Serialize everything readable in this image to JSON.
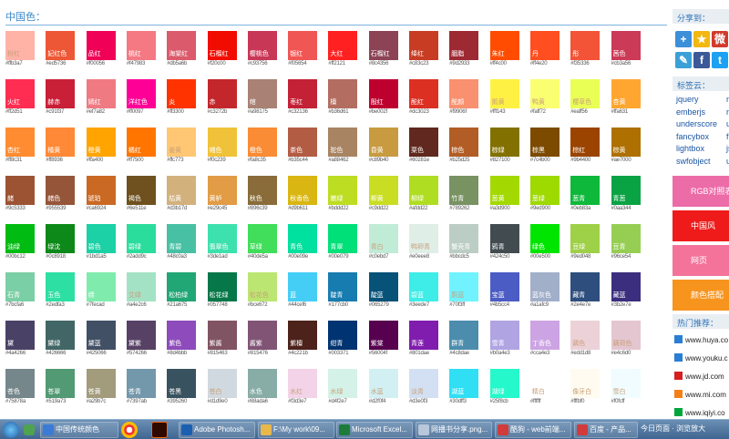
{
  "page": {
    "title": "中国色："
  },
  "colors": [
    {
      "name": "粉红",
      "hex": "#ffb3a7"
    },
    {
      "name": "妃红色",
      "hex": "#ed5736"
    },
    {
      "name": "品红",
      "hex": "#f00056"
    },
    {
      "name": "桃红",
      "hex": "#f47983"
    },
    {
      "name": "海棠红",
      "hex": "#db5a6b"
    },
    {
      "name": "石榴红",
      "hex": "#f20c00"
    },
    {
      "name": "樱桃色",
      "hex": "#c93756"
    },
    {
      "name": "银红",
      "hex": "#f05654"
    },
    {
      "name": "大红",
      "hex": "#ff2121"
    },
    {
      "name": "石榴红",
      "hex": "#8c4356"
    },
    {
      "name": "绛红",
      "hex": "#c83c23"
    },
    {
      "name": "胭脂",
      "hex": "#9d2933"
    },
    {
      "name": "朱红",
      "hex": "#ff4c00"
    },
    {
      "name": "丹",
      "hex": "#ff4e20"
    },
    {
      "name": "彤",
      "hex": "#f35336"
    },
    {
      "name": "茜色",
      "hex": "#cb3a56"
    },
    {
      "name": "火红",
      "hex": "#ff2d51"
    },
    {
      "name": "赫赤",
      "hex": "#c91f37"
    },
    {
      "name": "嫣红",
      "hex": "#ef7a82"
    },
    {
      "name": "洋红色",
      "hex": "#ff0097"
    },
    {
      "name": "炎",
      "hex": "#ff3300"
    },
    {
      "name": "赤",
      "hex": "#c3272b"
    },
    {
      "name": "绾",
      "hex": "#a98175"
    },
    {
      "name": "枣红",
      "hex": "#c32136"
    },
    {
      "name": "檀",
      "hex": "#b36d61"
    },
    {
      "name": "殷红",
      "hex": "#be002f"
    },
    {
      "name": "酡红",
      "hex": "#dc3023"
    },
    {
      "name": "酡颜",
      "hex": "#f9906f"
    },
    {
      "name": "鹅黄",
      "hex": "#fff143"
    },
    {
      "name": "鸭黄",
      "hex": "#faff72"
    },
    {
      "name": "樱草色",
      "hex": "#eaff56"
    },
    {
      "name": "杏黄",
      "hex": "#ffa631"
    },
    {
      "name": "杏红",
      "hex": "#ff8c31"
    },
    {
      "name": "橘黄",
      "hex": "#ff8936"
    },
    {
      "name": "橙黄",
      "hex": "#ffa400"
    },
    {
      "name": "橘红",
      "hex": "#ff7500"
    },
    {
      "name": "姜黄",
      "hex": "#ffc773"
    },
    {
      "name": "缃色",
      "hex": "#f0c239"
    },
    {
      "name": "橙色",
      "hex": "#fa8c35"
    },
    {
      "name": "茶色",
      "hex": "#b35c44"
    },
    {
      "name": "驼色",
      "hex": "#a88462"
    },
    {
      "name": "昏黄",
      "hex": "#c89b40"
    },
    {
      "name": "栗色",
      "hex": "#60281e"
    },
    {
      "name": "棕色",
      "hex": "#b25d25"
    },
    {
      "name": "棕绿",
      "hex": "#827100"
    },
    {
      "name": "棕黑",
      "hex": "#7c4b00"
    },
    {
      "name": "棕红",
      "hex": "#9b4400"
    },
    {
      "name": "棕黄",
      "hex": "#ae7000"
    },
    {
      "name": "赭",
      "hex": "#9c5333"
    },
    {
      "name": "赭色",
      "hex": "#955539"
    },
    {
      "name": "琥珀",
      "hex": "#ca6924"
    },
    {
      "name": "褐色",
      "hex": "#6e511e"
    },
    {
      "name": "枯黄",
      "hex": "#d3b17d"
    },
    {
      "name": "黄栌",
      "hex": "#e29c45"
    },
    {
      "name": "秋色",
      "hex": "#896c39"
    },
    {
      "name": "秋香色",
      "hex": "#d9b611"
    },
    {
      "name": "嫩绿",
      "hex": "#bddd22"
    },
    {
      "name": "柳黄",
      "hex": "#c9dd22"
    },
    {
      "name": "柳绿",
      "hex": "#afdd22"
    },
    {
      "name": "竹青",
      "hex": "#789262"
    },
    {
      "name": "葱黄",
      "hex": "#a3d900"
    },
    {
      "name": "葱绿",
      "hex": "#9ed900"
    },
    {
      "name": "葱青",
      "hex": "#0eb83a"
    },
    {
      "name": "青葱",
      "hex": "#0aa344"
    },
    {
      "name": "油绿",
      "hex": "#00bc12"
    },
    {
      "name": "绿沈",
      "hex": "#0c8918"
    },
    {
      "name": "碧色",
      "hex": "#1bd1a5"
    },
    {
      "name": "碧绿",
      "hex": "#2add9c"
    },
    {
      "name": "青碧",
      "hex": "#48c0a3"
    },
    {
      "name": "翡翠色",
      "hex": "#3de1ad"
    },
    {
      "name": "草绿",
      "hex": "#40de5a"
    },
    {
      "name": "青色",
      "hex": "#00e09e"
    },
    {
      "name": "青翠",
      "hex": "#00e079"
    },
    {
      "name": "青白",
      "hex": "#c0ebd7"
    },
    {
      "name": "鸭卵青",
      "hex": "#e0eee8"
    },
    {
      "name": "蟹壳青",
      "hex": "#bbcdc5"
    },
    {
      "name": "鸦青",
      "hex": "#424c50"
    },
    {
      "name": "绿色",
      "hex": "#00e500"
    },
    {
      "name": "豆绿",
      "hex": "#9ed048"
    },
    {
      "name": "豆青",
      "hex": "#96ce54"
    },
    {
      "name": "石青",
      "hex": "#7bcfa6"
    },
    {
      "name": "玉色",
      "hex": "#2edfa3"
    },
    {
      "name": "缥",
      "hex": "#7fecad"
    },
    {
      "name": "艾绿",
      "hex": "#a4e2c6"
    },
    {
      "name": "松柏绿",
      "hex": "#21a675"
    },
    {
      "name": "松花绿",
      "hex": "#057748"
    },
    {
      "name": "松花色",
      "hex": "#bce672"
    },
    {
      "name": "蓝",
      "hex": "#44cef6"
    },
    {
      "name": "靛青",
      "hex": "#177cb0"
    },
    {
      "name": "靛蓝",
      "hex": "#065279"
    },
    {
      "name": "碧蓝",
      "hex": "#3eede7"
    },
    {
      "name": "蔚蓝",
      "hex": "#70f3ff"
    },
    {
      "name": "宝蓝",
      "hex": "#4b5cc4"
    },
    {
      "name": "蓝灰色",
      "hex": "#a1afc9"
    },
    {
      "name": "藏青",
      "hex": "#2e4e7e"
    },
    {
      "name": "藏蓝",
      "hex": "#3b2e7e"
    },
    {
      "name": "黛",
      "hex": "#4a4266"
    },
    {
      "name": "黛绿",
      "hex": "#426666"
    },
    {
      "name": "黛蓝",
      "hex": "#425066"
    },
    {
      "name": "黛紫",
      "hex": "#574266"
    },
    {
      "name": "紫色",
      "hex": "#8d4bbb"
    },
    {
      "name": "紫酱",
      "hex": "#815463"
    },
    {
      "name": "酱紫",
      "hex": "#815476"
    },
    {
      "name": "紫檀",
      "hex": "#4c221b"
    },
    {
      "name": "绀青",
      "hex": "#003371"
    },
    {
      "name": "紫棠",
      "hex": "#56004f"
    },
    {
      "name": "青莲",
      "hex": "#801dae"
    },
    {
      "name": "群青",
      "hex": "#4c8dae"
    },
    {
      "name": "雪青",
      "hex": "#b0a4e3"
    },
    {
      "name": "丁香色",
      "hex": "#cca4e3"
    },
    {
      "name": "藕色",
      "hex": "#edd1d8"
    },
    {
      "name": "藕荷色",
      "hex": "#e4c6d0"
    },
    {
      "name": "苍色",
      "hex": "#75878a"
    },
    {
      "name": "苍翠",
      "hex": "#519a73"
    },
    {
      "name": "苍黄",
      "hex": "#a29b7c"
    },
    {
      "name": "苍青",
      "hex": "#7397ab"
    },
    {
      "name": "苍黑",
      "hex": "#395260"
    },
    {
      "name": "苍白",
      "hex": "#d1d9e0"
    },
    {
      "name": "水色",
      "hex": "#88ada6"
    },
    {
      "name": "水红",
      "hex": "#f3d3e7"
    },
    {
      "name": "水绿",
      "hex": "#d4f2e7"
    },
    {
      "name": "水蓝",
      "hex": "#d2f0f4"
    },
    {
      "name": "淡青",
      "hex": "#d3e0f3"
    },
    {
      "name": "湖蓝",
      "hex": "#30dff3"
    },
    {
      "name": "湖绿",
      "hex": "#25f8cb"
    },
    {
      "name": "精白",
      "hex": "#ffffff"
    },
    {
      "name": "像牙白",
      "hex": "#fffbf0"
    },
    {
      "name": "雪白",
      "hex": "#f0fcff"
    }
  ],
  "sidebar": {
    "share_label": "分享到：",
    "tags_label": "标签云：",
    "tags_col1": [
      "jquery",
      "emberjs",
      "underscore",
      "fancybox",
      "lightbox",
      "swfobject"
    ],
    "tags_col2": [
      "m",
      "n",
      "u",
      "f",
      "js",
      "u"
    ],
    "promos": [
      {
        "label": "RGB对照表",
        "color": "#ec6ca8"
      },
      {
        "label": "中国风",
        "color": "#ef1b1b"
      },
      {
        "label": "网页",
        "color": "#f3739a"
      },
      {
        "label": "颜色搭配",
        "color": "#f7941d"
      }
    ],
    "recommend_label": "热门推荐：",
    "links": [
      {
        "text": "www.huya.co",
        "icon_color": "#2a7ed3"
      },
      {
        "text": "www.youku.c",
        "icon_color": "#2a7ed3"
      },
      {
        "text": "www.jd.com",
        "icon_color": "#d42020"
      },
      {
        "text": "www.mi.com",
        "icon_color": "#f57f17"
      },
      {
        "text": "www.iqiyi.co",
        "icon_color": "#00a63b"
      },
      {
        "text": "www.sohu.co",
        "icon_color": "#f3c016"
      }
    ]
  },
  "taskbar": {
    "items": [
      {
        "label": "中国传统颜色",
        "icon_color": "#3a7bd5"
      },
      {
        "label": "Adobe Photosh...",
        "icon_color": "#1b5fb0"
      },
      {
        "label": "F:\\My work\\09...",
        "icon_color": "#e8b84a"
      },
      {
        "label": "Microsoft Excel...",
        "icon_color": "#1d7c3a"
      },
      {
        "label": "网播书分享.png...",
        "icon_color": "#b8c7d9"
      },
      {
        "label": "酷狗 - web前端...",
        "icon_color": "#d13b3b"
      },
      {
        "label": "百度 - 产品...",
        "icon_color": "#d13b3b"
      }
    ],
    "tray_text": "今日页面 · 浏览放大"
  }
}
